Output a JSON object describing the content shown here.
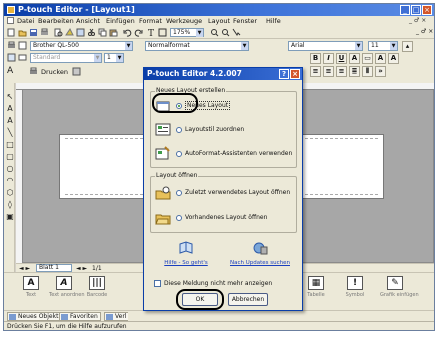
{
  "window": {
    "title": "P-touch Editor - [Layout1]",
    "controls": [
      "_",
      "□",
      "×"
    ]
  },
  "menu": {
    "items": [
      "Datei",
      "Bearbeiten",
      "Ansicht",
      "Einfügen",
      "Format",
      "Werkzeuge",
      "Layout",
      "Fenster",
      "Hilfe"
    ],
    "window_controls": "_ ♂ ×"
  },
  "toolbar": {
    "zoom": "175%",
    "printer": "Brother QL-500",
    "tape": "Standard",
    "tape_width": "1",
    "print_label": "Drucken",
    "style_box": "Normalformat",
    "font": "Arial",
    "font_size": "11",
    "bold": "B",
    "italic": "I",
    "underline": "U",
    "text_a": "A"
  },
  "pagebar": {
    "sheet": "Blatt 1",
    "page": "1/1"
  },
  "palette": {
    "items": [
      {
        "icon": "A",
        "label": "Text"
      },
      {
        "icon": "A",
        "label": "Text anordnen"
      },
      {
        "icon": "|||",
        "label": "Barcode"
      },
      {
        "icon": "▦",
        "label": "Tabelle"
      },
      {
        "icon": "!",
        "label": "Symbol"
      },
      {
        "icon": "✎",
        "label": "Grafik einfügen"
      }
    ]
  },
  "objbar": {
    "new_object": "Neues Objekt",
    "favorites": "Favoriten",
    "other": "Verl"
  },
  "status": "Drücken Sie F1, um die Hilfe aufzurufen",
  "dialog": {
    "title": "P-touch Editor 4.2.007",
    "help_btn": "?",
    "close_btn": "×",
    "group_create": {
      "label": "Neues Layout erstellen",
      "options": [
        {
          "label": "Neues Layout",
          "selected": true
        },
        {
          "label": "Layoutstil zuordnen",
          "selected": false
        },
        {
          "label": "AutoFormat-Assistenten verwenden",
          "selected": false
        }
      ]
    },
    "group_open": {
      "label": "Layout öffnen",
      "options": [
        {
          "label": "Zuletzt verwendetes Layout öffnen",
          "selected": false
        },
        {
          "label": "Vorhandenes Layout öffnen",
          "selected": false
        }
      ]
    },
    "links": {
      "help": "Hilfe - So geht's",
      "updates": "Nach Updates suchen"
    },
    "dont_show": "Diese Meldung nicht mehr anzeigen",
    "ok": "OK",
    "cancel": "Abbrechen"
  }
}
